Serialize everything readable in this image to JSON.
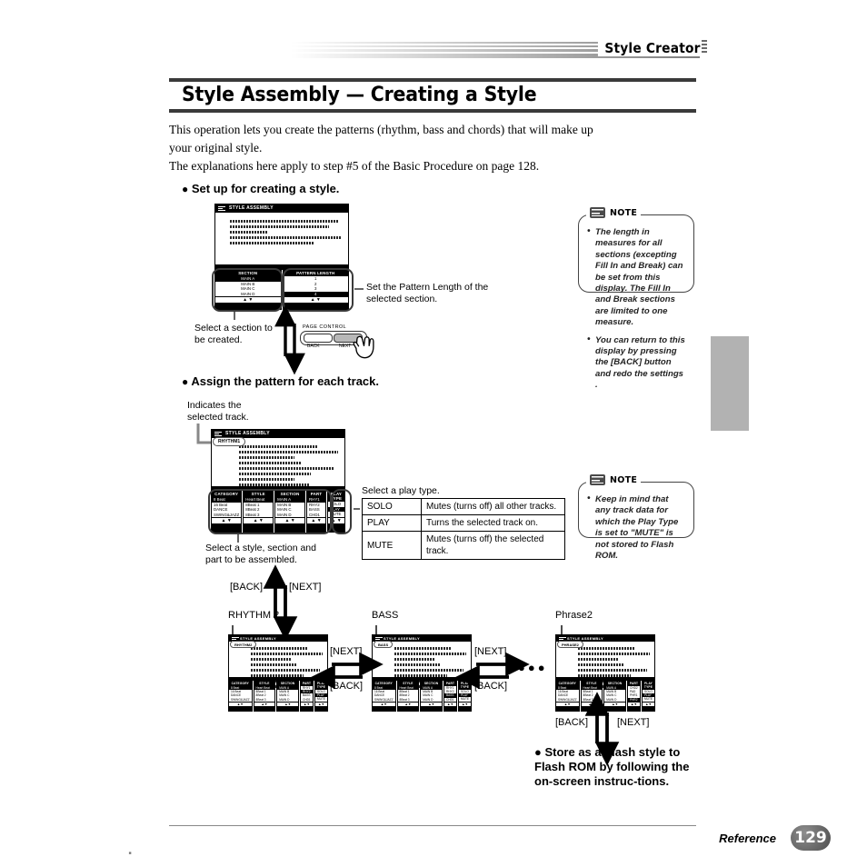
{
  "header": {
    "running_head": "Style Creator",
    "title": "Style Assembly — Creating a Style"
  },
  "intro": {
    "line1": "This operation lets you create the patterns (rhythm, bass and chords) that will make up",
    "line2": "your original style.",
    "line3": "The explanations here apply to step #5 of the Basic Procedure on page 128."
  },
  "section1": {
    "heading": "Set up for creating a style.",
    "lcd": {
      "titlebar": "STYLE ASSEMBLY",
      "message": [
        "Select the section you want to create,",
        "and set the length in bars of the",
        "Pattern.",
        "Generally, this will be 2 bars or 4 bars.",
        "Press [NEXT] to continue."
      ],
      "columns": [
        {
          "header": "SECTION",
          "rows": [
            "MAIN A",
            "MAIN B",
            "MAIN C",
            "MAIN D"
          ],
          "selected": 0
        },
        {
          "header": "PATTERN LENGTH",
          "rows": [
            "1",
            "2",
            "3",
            "4"
          ],
          "selected": 3
        }
      ],
      "spinner": "▲ ▼"
    },
    "callout_left": "Select a section to\nbe created.",
    "callout_right": "Set the Pattern Length of the\nselected section.",
    "page_control": {
      "label": "PAGE CONTROL",
      "back": "BACK",
      "next": "NEXT"
    }
  },
  "note1": {
    "caption": "NOTE",
    "items": [
      "The length in measures for all sections (excepting Fill In and Break) can be set from this display. The Fill In and Break sections are limited to one measure.",
      "You can return to this display by pressing the [BACK] button and redo the settings ."
    ]
  },
  "section2": {
    "heading": "Assign the pattern for each track.",
    "callout_track": "Indicates the\nselected track.",
    "callout_bottom": "Select a style, section and\npart to be assembled.",
    "callout_playtype": "Select a play type.",
    "lcd": {
      "titlebar": "STYLE ASSEMBLY",
      "track_tag": "RHYTHM1",
      "message": [
        "Select a pattern for RHYTHM1.",
        "Using Category, Style, Section and Part,",
        "you can access all of the",
        "pre-programmed patterns.",
        "Press [START] to audition the pattern.",
        "Play Type lets you solo or mute",
        "the current pattern.",
        "Press [NEXT] to continue."
      ],
      "columns": [
        {
          "header": "CATEGORY",
          "rows": [
            "8 Beat",
            "16 Beat",
            "DANCE",
            "SWING&JAZZ"
          ],
          "selected": 0
        },
        {
          "header": "STYLE",
          "rows": [
            "Heart Beat",
            "8Beat 1",
            "8Beat 2",
            "8Beat 3"
          ],
          "selected": 0
        },
        {
          "header": "SECTION",
          "rows": [
            "MAIN A",
            "MAIN B",
            "MAIN C",
            "MAIN D"
          ],
          "selected": 0
        },
        {
          "header": "PART",
          "rows": [
            "RHY1",
            "RHY2",
            "BASS",
            "CHD1"
          ],
          "selected": 0
        },
        {
          "header": "PLAY TYPE",
          "rows": [
            "SOLO",
            "PLAY",
            "MUTE"
          ],
          "selected": 1
        }
      ],
      "spinner": "▲ ▼"
    },
    "playtype_table": {
      "rows": [
        {
          "key": "SOLO",
          "desc": "Mutes (turns off) all other tracks."
        },
        {
          "key": "PLAY",
          "desc": "Turns the selected track on."
        },
        {
          "key": "MUTE",
          "desc": "Mutes (turns off) the selected track."
        }
      ]
    }
  },
  "note2": {
    "caption": "NOTE",
    "items": [
      "Keep in mind that any track data for which the Play Type is set to \"MUTE\" is not stored to Flash ROM."
    ]
  },
  "flow": {
    "back_label": "[BACK]",
    "next_label": "[NEXT]",
    "ellipsis": "●●●",
    "screens": [
      {
        "caption": "RHYTHM 2",
        "titlebar": "STYLE ASSEMBLY",
        "track_tag": "RHYTHM2",
        "message": [
          "Select a pattern for RHYTHM2.",
          "Using Category, Style, Section and Part,",
          "you can access all of the",
          "pre-programmed patterns.",
          "Press [START] to audition the pattern.",
          "Play Type lets you solo or mute",
          "the current pattern.",
          "Press [NEXT] to continue."
        ],
        "columns": [
          {
            "header": "CATEGORY",
            "rows": [
              "8 Beat",
              "16 Beat",
              "DANCE",
              "SWING&JAZZ"
            ],
            "selected": 0
          },
          {
            "header": "STYLE",
            "rows": [
              "Heart Beat",
              "8Beat 1",
              "8Beat 2",
              "8Beat 3"
            ],
            "selected": 0
          },
          {
            "header": "SECTION",
            "rows": [
              "MAIN A",
              "MAIN B",
              "MAIN C",
              "MAIN D"
            ],
            "selected": 0
          },
          {
            "header": "PART",
            "rows": [
              "RHY1",
              "RHY2",
              "BASS",
              "CHD1"
            ],
            "selected": 1
          },
          {
            "header": "PLAY TYPE",
            "rows": [
              "SOLO",
              "PLAY",
              "MUTE"
            ],
            "selected": 1
          }
        ]
      },
      {
        "caption": "BASS",
        "titlebar": "STYLE ASSEMBLY",
        "track_tag": "BASS",
        "message": [
          "Select a pattern for BASS.",
          "Using Category, Style, Section and Part,",
          "you can access all of the",
          "pre-programmed patterns.",
          "Press [START] to audition the pattern.",
          "Play Type lets you solo or mute",
          "the current pattern.",
          "Press [NEXT] to continue."
        ],
        "columns": [
          {
            "header": "CATEGORY",
            "rows": [
              "8 Beat",
              "16 Beat",
              "DANCE",
              "SWING&JAZZ"
            ],
            "selected": 0
          },
          {
            "header": "STYLE",
            "rows": [
              "Heart Beat",
              "8Beat 1",
              "8Beat 2",
              "8Beat 3"
            ],
            "selected": 0
          },
          {
            "header": "SECTION",
            "rows": [
              "MAIN A",
              "MAIN B",
              "MAIN C",
              "MAIN D"
            ],
            "selected": 0
          },
          {
            "header": "PART",
            "rows": [
              "RHY1",
              "RHY2",
              "BASS",
              "CHD1"
            ],
            "selected": 2
          },
          {
            "header": "PLAY TYPE",
            "rows": [
              "SOLO",
              "PLAY",
              "MUTE"
            ],
            "selected": 1
          }
        ]
      },
      {
        "caption": "Phrase2",
        "titlebar": "STYLE ASSEMBLY",
        "track_tag": "PHRASE2",
        "message": [
          "Select a pattern for PHRASE2.",
          "Using Category, Style, Section and Part,",
          "you can access all of the",
          "pre-programmed patterns.",
          "Press [START] to audition the pattern.",
          "Play Type lets you solo or mute",
          "the current pattern.",
          "Press [NEXT] to continue."
        ],
        "columns": [
          {
            "header": "CATEGORY",
            "rows": [
              "8 Beat",
              "16 Beat",
              "DANCE",
              "SWING&JAZZ"
            ],
            "selected": 0
          },
          {
            "header": "STYLE",
            "rows": [
              "Heart Beat",
              "8Beat 1",
              "8Beat 2",
              "8Beat 3"
            ],
            "selected": 0
          },
          {
            "header": "SECTION",
            "rows": [
              "MAIN A",
              "MAIN B",
              "MAIN C",
              "MAIN D"
            ],
            "selected": 0
          },
          {
            "header": "PART",
            "rows": [
              "CHD2",
              "PAD",
              "PHR1",
              "PHR2"
            ],
            "selected": 3
          },
          {
            "header": "PLAY TYPE",
            "rows": [
              "SOLO",
              "PLAY",
              "MUTE"
            ],
            "selected": 1
          }
        ]
      }
    ]
  },
  "section3": {
    "heading": "Store as a Flash style to Flash ROM by following the on-screen instruc-​tions."
  },
  "footer": {
    "reference": "Reference",
    "page": "129"
  }
}
